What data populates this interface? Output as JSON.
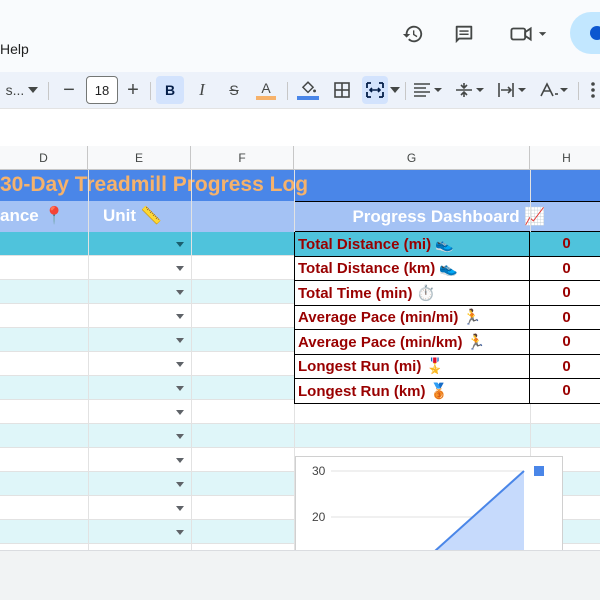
{
  "menu": {
    "help": "Help"
  },
  "toolbar": {
    "font_name": "s...",
    "font_size": "18",
    "minus": "−",
    "plus": "+",
    "bold": "B",
    "italic": "I",
    "strike": "S",
    "text_color": "A",
    "text_color_bar": "#f6b26b",
    "fill_bar": "#4a86e8"
  },
  "columns": [
    "D",
    "E",
    "F",
    "G",
    "H"
  ],
  "sheet": {
    "title": "30-Day Treadmill Progress Log",
    "header_distance": "ance 📍",
    "header_unit": "Unit 📏",
    "dashboard_title": "Progress Dashboard 📈"
  },
  "dashboard": [
    {
      "label": "Total Distance (mi) 👟",
      "value": "0"
    },
    {
      "label": "Total Distance (km) 👟",
      "value": "0"
    },
    {
      "label": "Total Time (min) ⏱️",
      "value": "0"
    },
    {
      "label": "Average Pace (min/mi) 🏃",
      "value": "0"
    },
    {
      "label": "Average Pace (min/km) 🏃",
      "value": "0"
    },
    {
      "label": "Longest Run (mi) 🎖️",
      "value": "0"
    },
    {
      "label": "Longest Run (km) 🥉",
      "value": "0"
    }
  ],
  "chart_data": {
    "type": "area",
    "x": [
      0,
      1
    ],
    "series": [
      {
        "values": [
          0,
          30
        ]
      }
    ],
    "yticks": [
      "30",
      "20"
    ],
    "ylim": [
      0,
      30
    ],
    "color": "#4a86e8",
    "fill": "#c6dafc"
  },
  "colors": {
    "title_bg": "#4a86e8",
    "header_bg": "#a4c2f4",
    "first_row": "#4fc3dc",
    "alt_row": "#dff6f9",
    "metric_text": "#990000"
  }
}
